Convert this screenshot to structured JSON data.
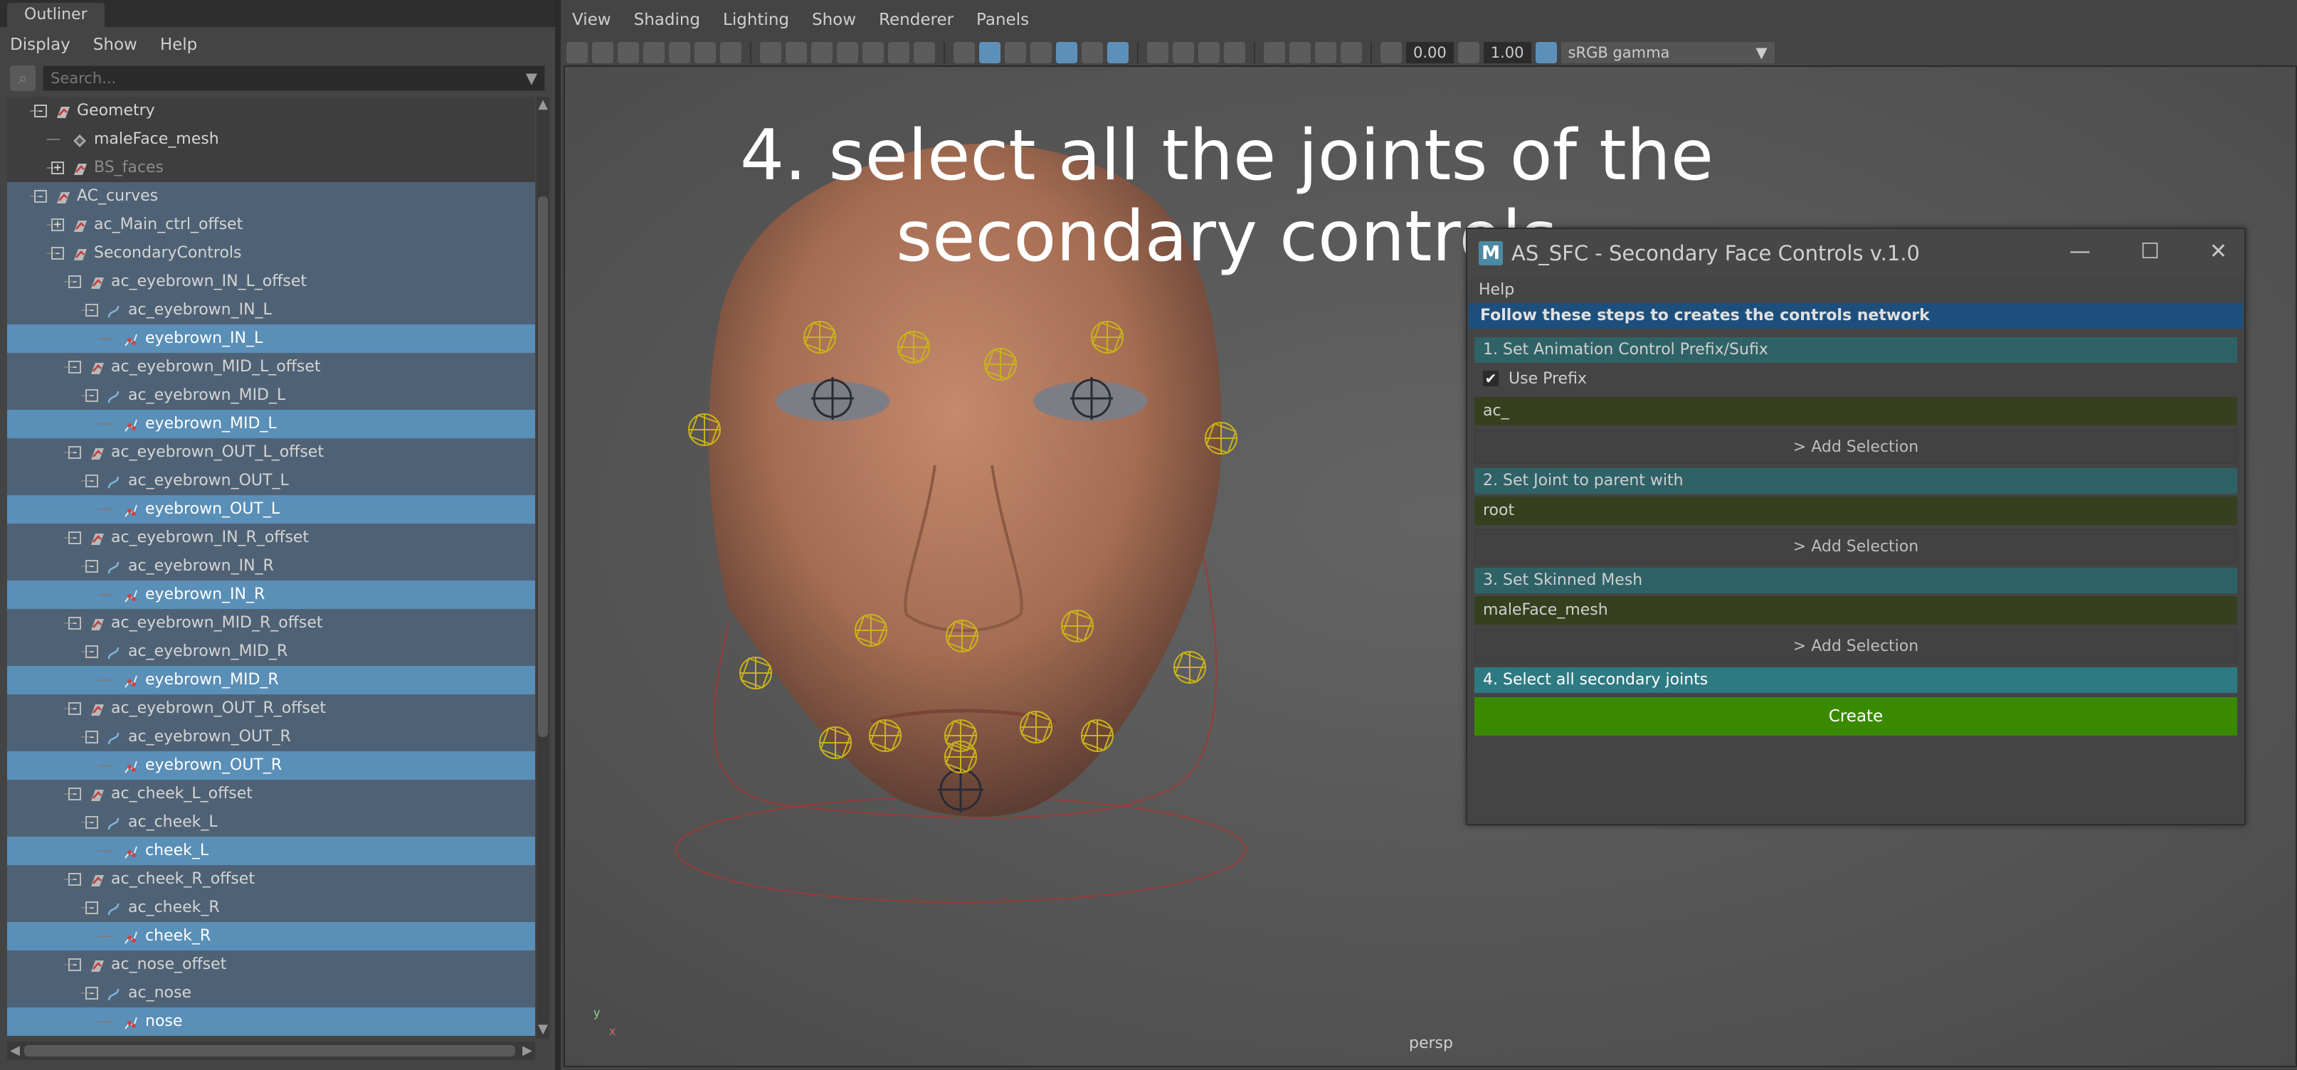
{
  "outliner": {
    "tab_label": "Outliner",
    "menu": [
      "Display",
      "Show",
      "Help"
    ],
    "search_placeholder": "Search...",
    "rows": [
      {
        "label": "Geometry",
        "kind": "group",
        "indent": 1,
        "expander": "-",
        "style": "dark"
      },
      {
        "label": "maleFace_mesh",
        "kind": "mesh",
        "indent": 2,
        "expander": "",
        "style": "dark"
      },
      {
        "label": "BS_faces",
        "kind": "group",
        "indent": 2,
        "expander": "+",
        "style": "dark-dim"
      },
      {
        "label": "AC_curves",
        "kind": "group",
        "indent": 1,
        "expander": "-",
        "style": "sel-group"
      },
      {
        "label": "ac_Main_ctrl_offset",
        "kind": "group",
        "indent": 2,
        "expander": "+",
        "style": "sel-group"
      },
      {
        "label": "SecondaryControls",
        "kind": "group",
        "indent": 2,
        "expander": "-",
        "style": "sel-group"
      },
      {
        "label": "ac_eyebrown_IN_L_offset",
        "kind": "group",
        "indent": 3,
        "expander": "-",
        "style": "sel-group"
      },
      {
        "label": "ac_eyebrown_IN_L",
        "kind": "curve",
        "indent": 4,
        "expander": "-",
        "style": "sel-group"
      },
      {
        "label": "eyebrown_IN_L",
        "kind": "joint",
        "indent": 5,
        "expander": "",
        "style": "sel-joint"
      },
      {
        "label": "ac_eyebrown_MID_L_offset",
        "kind": "group",
        "indent": 3,
        "expander": "-",
        "style": "sel-group"
      },
      {
        "label": "ac_eyebrown_MID_L",
        "kind": "curve",
        "indent": 4,
        "expander": "-",
        "style": "sel-group"
      },
      {
        "label": "eyebrown_MID_L",
        "kind": "joint",
        "indent": 5,
        "expander": "",
        "style": "sel-joint"
      },
      {
        "label": "ac_eyebrown_OUT_L_offset",
        "kind": "group",
        "indent": 3,
        "expander": "-",
        "style": "sel-group"
      },
      {
        "label": "ac_eyebrown_OUT_L",
        "kind": "curve",
        "indent": 4,
        "expander": "-",
        "style": "sel-group"
      },
      {
        "label": "eyebrown_OUT_L",
        "kind": "joint",
        "indent": 5,
        "expander": "",
        "style": "sel-joint"
      },
      {
        "label": "ac_eyebrown_IN_R_offset",
        "kind": "group",
        "indent": 3,
        "expander": "-",
        "style": "sel-group"
      },
      {
        "label": "ac_eyebrown_IN_R",
        "kind": "curve",
        "indent": 4,
        "expander": "-",
        "style": "sel-group"
      },
      {
        "label": "eyebrown_IN_R",
        "kind": "joint",
        "indent": 5,
        "expander": "",
        "style": "sel-joint"
      },
      {
        "label": "ac_eyebrown_MID_R_offset",
        "kind": "group",
        "indent": 3,
        "expander": "-",
        "style": "sel-group"
      },
      {
        "label": "ac_eyebrown_MID_R",
        "kind": "curve",
        "indent": 4,
        "expander": "-",
        "style": "sel-group"
      },
      {
        "label": "eyebrown_MID_R",
        "kind": "joint",
        "indent": 5,
        "expander": "",
        "style": "sel-joint"
      },
      {
        "label": "ac_eyebrown_OUT_R_offset",
        "kind": "group",
        "indent": 3,
        "expander": "-",
        "style": "sel-group"
      },
      {
        "label": "ac_eyebrown_OUT_R",
        "kind": "curve",
        "indent": 4,
        "expander": "-",
        "style": "sel-group"
      },
      {
        "label": "eyebrown_OUT_R",
        "kind": "joint",
        "indent": 5,
        "expander": "",
        "style": "sel-joint"
      },
      {
        "label": "ac_cheek_L_offset",
        "kind": "group",
        "indent": 3,
        "expander": "-",
        "style": "sel-group"
      },
      {
        "label": "ac_cheek_L",
        "kind": "curve",
        "indent": 4,
        "expander": "-",
        "style": "sel-group"
      },
      {
        "label": "cheek_L",
        "kind": "joint",
        "indent": 5,
        "expander": "",
        "style": "sel-joint"
      },
      {
        "label": "ac_cheek_R_offset",
        "kind": "group",
        "indent": 3,
        "expander": "-",
        "style": "sel-group"
      },
      {
        "label": "ac_cheek_R",
        "kind": "curve",
        "indent": 4,
        "expander": "-",
        "style": "sel-group"
      },
      {
        "label": "cheek_R",
        "kind": "joint",
        "indent": 5,
        "expander": "",
        "style": "sel-joint"
      },
      {
        "label": "ac_nose_offset",
        "kind": "group",
        "indent": 3,
        "expander": "-",
        "style": "sel-group"
      },
      {
        "label": "ac_nose",
        "kind": "curve",
        "indent": 4,
        "expander": "-",
        "style": "sel-group"
      },
      {
        "label": "nose",
        "kind": "joint",
        "indent": 5,
        "expander": "",
        "style": "sel-joint"
      }
    ]
  },
  "viewport": {
    "menu": [
      "View",
      "Shading",
      "Lighting",
      "Show",
      "Renderer",
      "Panels"
    ],
    "exposure_value": "0.00",
    "gamma_value": "1.00",
    "color_space": "sRGB gamma",
    "overlay_title": "4. select all the joints of the secondary controls",
    "camera_label": "persp",
    "axis_x": "x",
    "axis_y": "y"
  },
  "dialog": {
    "logo": "M",
    "title": "AS_SFC - Secondary Face Controls v.1.0",
    "menu_help": "Help",
    "header": "Follow these steps to creates the controls network",
    "step1_label": "1. Set Animation Control Prefix/Sufix",
    "use_prefix_label": "Use Prefix",
    "use_prefix_checked": true,
    "prefix_value": "ac_",
    "add_selection_label": "> Add Selection",
    "step2_label": "2. Set Joint to parent with",
    "joint_value": "root",
    "step3_label": "3. Set Skinned Mesh",
    "mesh_value": "maleFace_mesh",
    "step4_label": "4. Select all secondary joints",
    "create_label": "Create"
  },
  "colors": {
    "selected_joint_row": "#5a8fb8",
    "selected_group_row": "#4f6275",
    "dialog_header": "#1d4f7d",
    "create_button": "#3a8a00",
    "step_label": "#2f6266",
    "input_field": "#36401f",
    "viewport_bg": "#5c5c5c",
    "control_curves": "#c9b21b",
    "skin": "#b47d62"
  }
}
